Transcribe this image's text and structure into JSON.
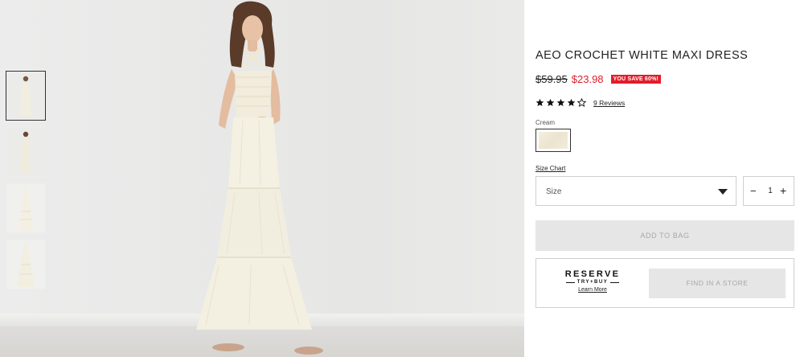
{
  "product": {
    "title": "AEO CROCHET WHITE MAXI DRESS",
    "old_price": "$59.95",
    "new_price": "$23.98",
    "save_badge": "YOU SAVE 60%!",
    "rating": 4.5,
    "rating_max": 5,
    "reviews_link": "9 Reviews",
    "color_label": "Cream",
    "size_chart_link": "Size Chart",
    "size_placeholder": "Size",
    "quantity": "1",
    "qty_minus": "−",
    "qty_plus": "+",
    "add_to_bag": "ADD TO BAG",
    "find_store": "FIND IN A STORE"
  },
  "reserve": {
    "title": "RESERVE",
    "subtitle": "TRY+BUY",
    "learn_more": "Learn More"
  },
  "gallery": {
    "thumbnail_count": 4,
    "selected_index": 0
  },
  "colors": {
    "sale_red": "#e21d2a",
    "disabled_bg": "#e6e6e6",
    "disabled_text": "#a8a8a8",
    "dress_cream": "#f3efe1"
  },
  "icons": {
    "star": "star-icon",
    "caret": "chevron-down-icon"
  }
}
